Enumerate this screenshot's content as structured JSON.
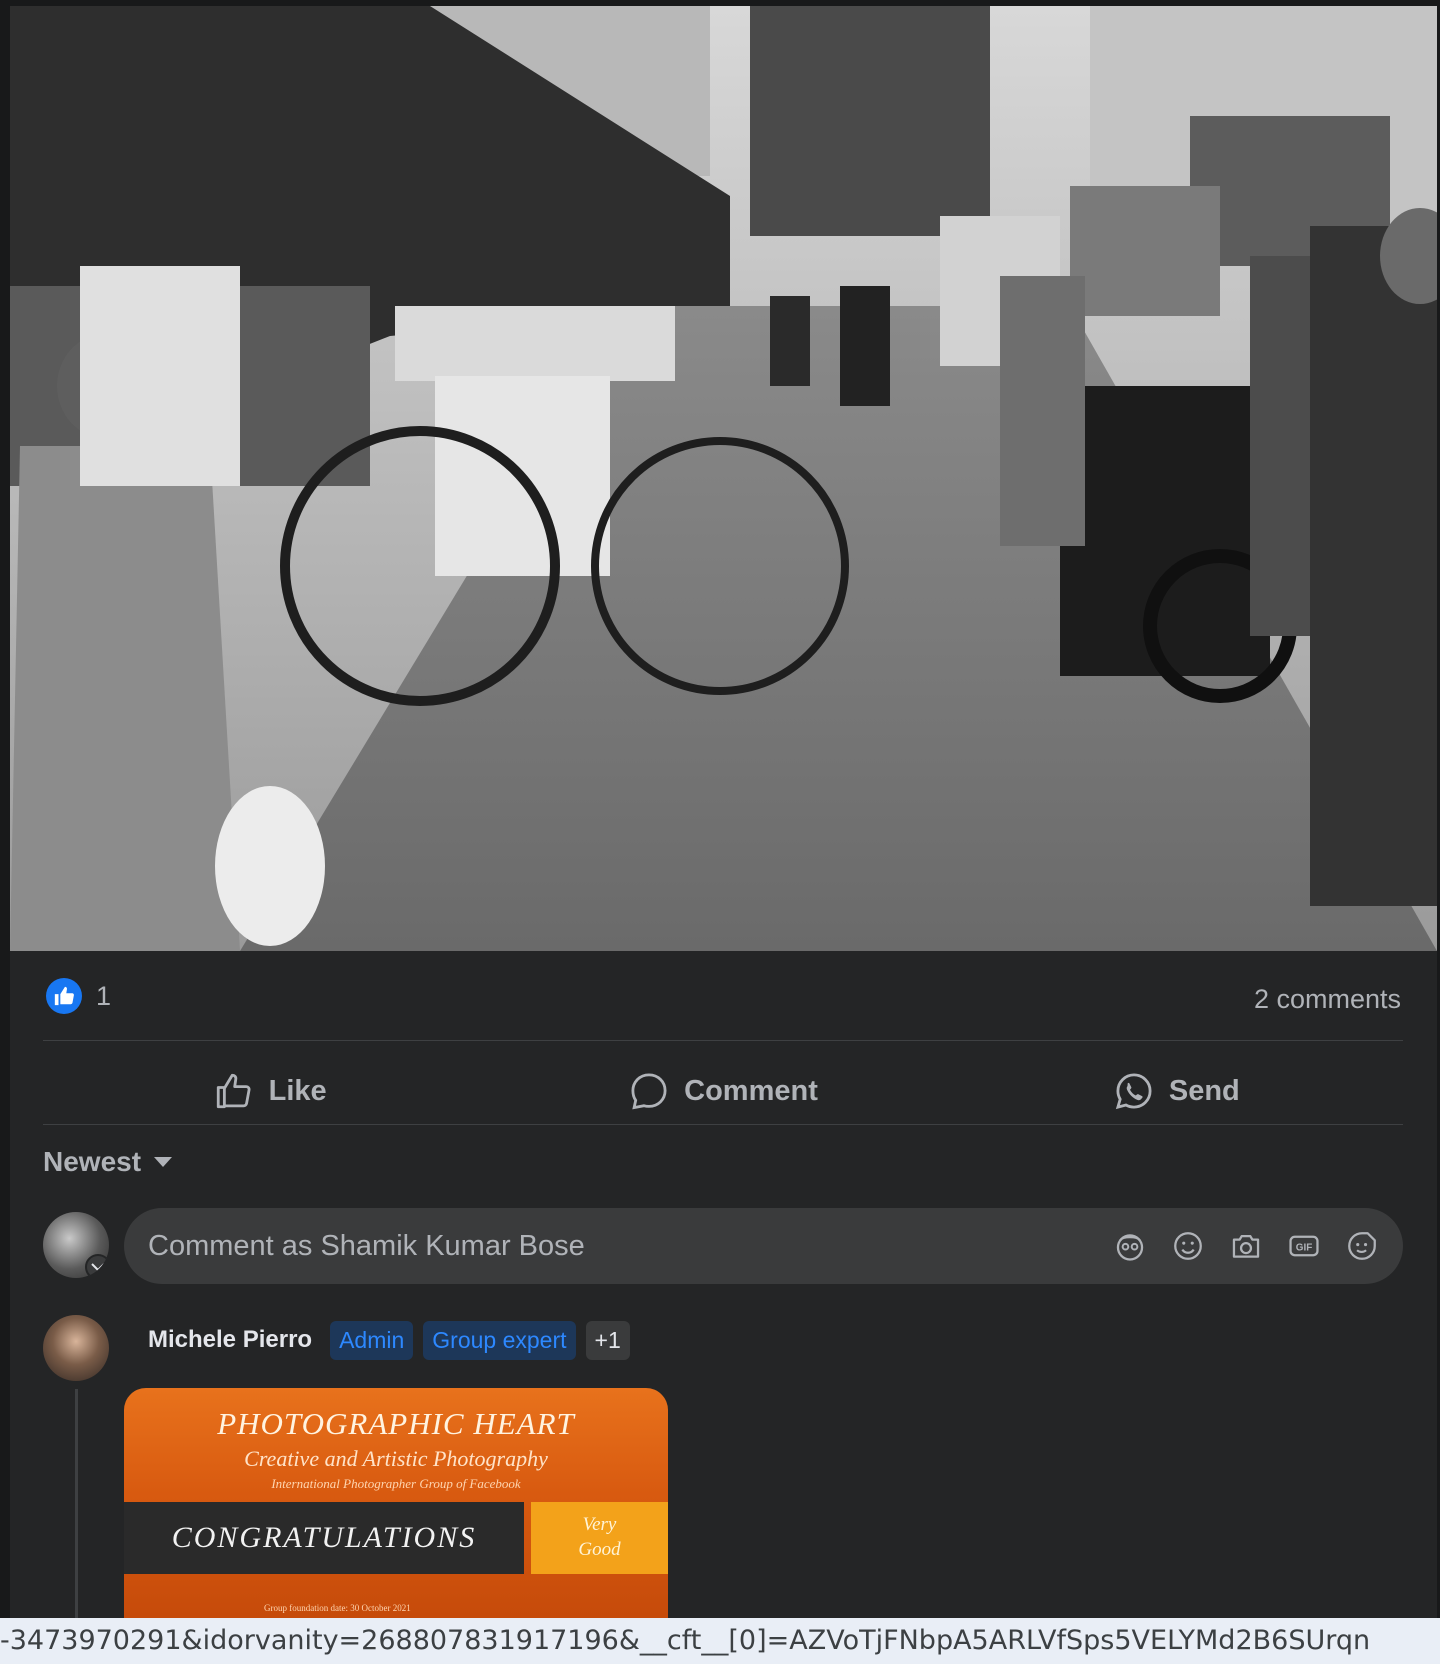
{
  "post": {
    "photo_icon": "street-market-photo",
    "reaction_count": "1",
    "comments_count_label": "2 comments"
  },
  "actions": {
    "like_label": "Like",
    "comment_label": "Comment",
    "send_label": "Send"
  },
  "sort": {
    "label": "Newest"
  },
  "composer": {
    "placeholder": "Comment as Shamik Kumar Bose",
    "icons": [
      "avatar-sticker-icon",
      "emoji-icon",
      "camera-icon",
      "gif-icon",
      "sticker-icon"
    ]
  },
  "comment": {
    "author": "Michele Pierro",
    "badges": [
      "Admin",
      "Group expert"
    ],
    "more_badges": "+1",
    "attachment": {
      "title": "PHOTOGRAPHIC HEART",
      "subtitle": "Creative and Artistic Photography",
      "tagline": "International Photographer Group of Facebook",
      "banner": "CONGRATULATIONS",
      "grade_line1": "Very",
      "grade_line2": "Good",
      "footer": "Group foundation date: 30 October 2021"
    }
  },
  "status_bar": {
    "url": "-3473970291&idorvanity=268807831917196&__cft__[0]=AZVoTjFNbpA5ARLVfSps5VELYMd2B6SUrqn"
  },
  "colors": {
    "background": "#242526",
    "accent": "#1877f2",
    "text_secondary": "#b0b3b8"
  }
}
